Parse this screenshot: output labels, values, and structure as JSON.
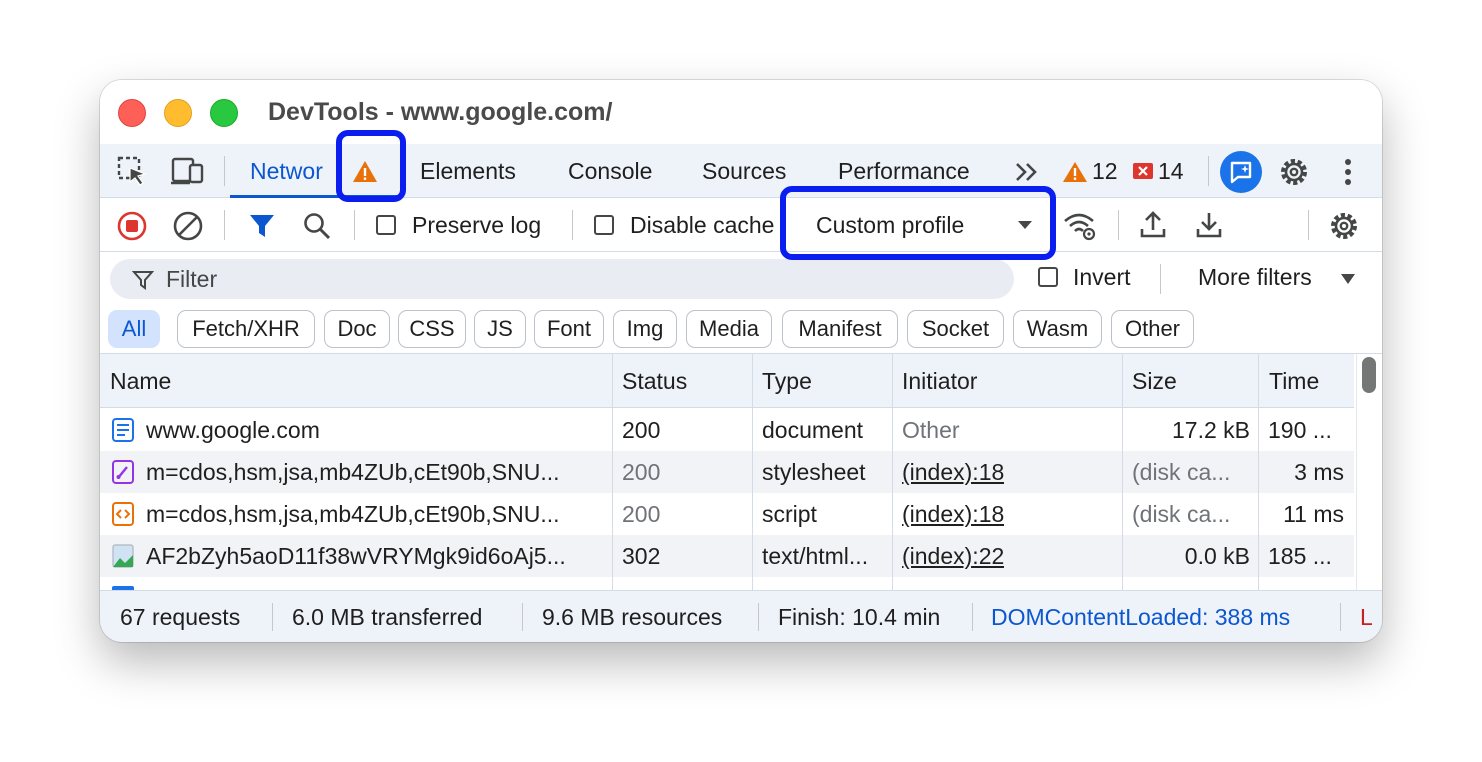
{
  "window": {
    "title": "DevTools - www.google.com/"
  },
  "tabs": {
    "items": [
      {
        "label": "Network",
        "visible": "Networ"
      },
      {
        "label": "Elements"
      },
      {
        "label": "Console"
      },
      {
        "label": "Sources"
      },
      {
        "label": "Performance"
      }
    ],
    "warnings_count": "12",
    "errors_count": "14"
  },
  "actionbar": {
    "preserve_log": "Preserve log",
    "disable_cache": "Disable cache",
    "throttling_value": "Custom profile"
  },
  "filter": {
    "placeholder": "Filter",
    "invert": "Invert",
    "more_filters": "More filters"
  },
  "chips": [
    "All",
    "Fetch/XHR",
    "Doc",
    "CSS",
    "JS",
    "Font",
    "Img",
    "Media",
    "Manifest",
    "Socket",
    "Wasm",
    "Other"
  ],
  "table": {
    "columns": [
      "Name",
      "Status",
      "Type",
      "Initiator",
      "Size",
      "Time"
    ],
    "rows": [
      {
        "name": "www.google.com",
        "status": "200",
        "type": "document",
        "initiator": "Other",
        "size": "17.2 kB",
        "time": "190 ...",
        "icon": "document-icon"
      },
      {
        "name": "m=cdos,hsm,jsa,mb4ZUb,cEt90b,SNU...",
        "status": "200",
        "type": "stylesheet",
        "initiator": "(index):18",
        "size": "(disk ca...",
        "time": "3 ms",
        "icon": "stylesheet-icon"
      },
      {
        "name": "m=cdos,hsm,jsa,mb4ZUb,cEt90b,SNU...",
        "status": "200",
        "type": "script",
        "initiator": "(index):18",
        "size": "(disk ca...",
        "time": "11 ms",
        "icon": "script-icon"
      },
      {
        "name": "AF2bZyh5aoD11f38wVRYMgk9id6oAj5...",
        "status": "302",
        "type": "text/html...",
        "initiator": "(index):22",
        "size": "0.0 kB",
        "time": "185 ...",
        "icon": "image-icon"
      }
    ]
  },
  "status": {
    "requests": "67 requests",
    "transferred": "6.0 MB transferred",
    "resources": "9.6 MB resources",
    "finish": "Finish: 10.4 min",
    "dcl": "DOMContentLoaded: 388 ms",
    "load": "L"
  },
  "colors": {
    "accent": "#0b57d0",
    "highlight": "#0a1ef0",
    "warning": "#e8710a",
    "error": "#dc362e",
    "record": "#dc362e"
  }
}
